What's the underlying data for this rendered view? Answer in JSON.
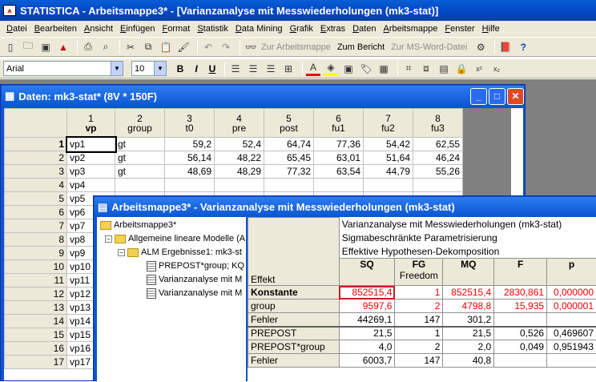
{
  "app_title": "STATISTICA - Arbeitsmappe3* - [Varianzanalyse mit Messwiederholungen (mk3-stat)]",
  "menu": [
    "Datei",
    "Bearbeiten",
    "Ansicht",
    "Einfügen",
    "Format",
    "Statistik",
    "Data Mining",
    "Grafik",
    "Extras",
    "Daten",
    "Arbeitsmappe",
    "Fenster",
    "Hilfe"
  ],
  "toolbar": {
    "to_workbook": "Zur Arbeitsmappe",
    "to_report": "Zum Bericht",
    "to_word": "Zur MS-Word-Datei"
  },
  "format": {
    "font": "Arial",
    "size": "10",
    "bold": "B",
    "italic": "I",
    "underline": "U"
  },
  "data_window": {
    "title": "Daten: mk3-stat* (8V * 150F)",
    "columns": [
      {
        "num": "1",
        "name": "vp"
      },
      {
        "num": "2",
        "name": "group"
      },
      {
        "num": "3",
        "name": "t0"
      },
      {
        "num": "4",
        "name": "pre"
      },
      {
        "num": "5",
        "name": "post"
      },
      {
        "num": "6",
        "name": "fu1"
      },
      {
        "num": "7",
        "name": "fu2"
      },
      {
        "num": "8",
        "name": "fu3"
      }
    ],
    "rows": [
      {
        "n": "1",
        "vp": "vp1",
        "group": "gt",
        "vals": [
          "59,2",
          "52,4",
          "64,74",
          "77,36",
          "54,42",
          "62,55"
        ]
      },
      {
        "n": "2",
        "vp": "vp2",
        "group": "gt",
        "vals": [
          "56,14",
          "48,22",
          "65,45",
          "63,01",
          "51,64",
          "46,24"
        ]
      },
      {
        "n": "3",
        "vp": "vp3",
        "group": "gt",
        "vals": [
          "48,69",
          "48,29",
          "77,32",
          "63,54",
          "44,79",
          "55,26"
        ]
      },
      {
        "n": "4",
        "vp": "vp4"
      },
      {
        "n": "5",
        "vp": "vp5"
      },
      {
        "n": "6",
        "vp": "vp6"
      },
      {
        "n": "7",
        "vp": "vp7"
      },
      {
        "n": "8",
        "vp": "vp8"
      },
      {
        "n": "9",
        "vp": "vp9"
      },
      {
        "n": "10",
        "vp": "vp10"
      },
      {
        "n": "11",
        "vp": "vp11"
      },
      {
        "n": "12",
        "vp": "vp12"
      },
      {
        "n": "13",
        "vp": "vp13"
      },
      {
        "n": "14",
        "vp": "vp14"
      },
      {
        "n": "15",
        "vp": "vp15"
      },
      {
        "n": "16",
        "vp": "vp16"
      },
      {
        "n": "17",
        "vp": "vp17"
      }
    ]
  },
  "workbook": {
    "title": "Arbeitsmappe3* - Varianzanalyse mit Messwiederholungen (mk3-stat)",
    "tree": {
      "root": "Arbeitsmappe3*",
      "alm": "Allgemeine lineare Modelle (A",
      "results": "ALM Ergebnisse1: mk3-st",
      "prepost": "PREPOST*group; KQ",
      "va1": "Varianzanalyse mit M",
      "va2": "Varianzanalyse mit M"
    },
    "header_lines": [
      "Varianzanalyse mit Messwiederholungen (mk3-stat)",
      "Sigmabeschränkte Parametrisierung",
      "Effektive Hypothesen-Dekomposition"
    ],
    "effect_label": "Effekt",
    "col_headers": [
      "SQ",
      "FG",
      "MQ",
      "F",
      "p"
    ],
    "fg_sub": "Freedom",
    "rows": [
      {
        "name": "Konstante",
        "bold": true,
        "red": true,
        "v": [
          "852515,4",
          "1",
          "852515,4",
          "2830,861",
          "0,000000"
        ]
      },
      {
        "name": "group",
        "red": true,
        "v": [
          "9597,6",
          "2",
          "4798,8",
          "15,935",
          "0,000001"
        ]
      },
      {
        "name": "Fehler",
        "v": [
          "44269,1",
          "147",
          "301,2",
          "",
          ""
        ]
      },
      {
        "name": "PREPOST",
        "v": [
          "21,5",
          "1",
          "21,5",
          "0,526",
          "0,469607"
        ]
      },
      {
        "name": "PREPOST*group",
        "v": [
          "4,0",
          "2",
          "2,0",
          "0,049",
          "0,951943"
        ]
      },
      {
        "name": "Fehler",
        "v": [
          "6003,7",
          "147",
          "40,8",
          "",
          ""
        ]
      }
    ]
  }
}
